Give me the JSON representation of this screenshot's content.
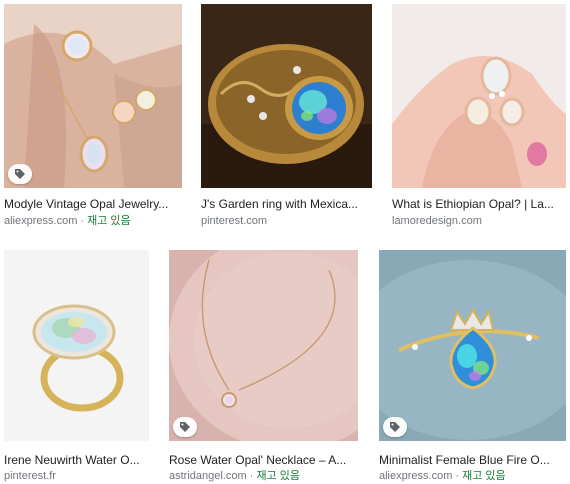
{
  "results": [
    {
      "title": "Modyle Vintage Opal Jewelry...",
      "source": "aliexpress.com",
      "separator": " · ",
      "stock": "재고 있음",
      "tag_icon": "tag-icon"
    },
    {
      "title": "J's Garden ring with Mexica...",
      "source": "pinterest.com",
      "separator": "",
      "stock": "",
      "tag_icon": ""
    },
    {
      "title": "What is Ethiopian Opal? | La...",
      "source": "lamoredesign.com",
      "separator": "",
      "stock": "",
      "tag_icon": ""
    },
    {
      "title": "Irene Neuwirth Water O...",
      "source": "pinterest.fr",
      "separator": "",
      "stock": "",
      "tag_icon": ""
    },
    {
      "title": "Rose Water Opal' Necklace – A...",
      "source": "astridangel.com",
      "separator": " · ",
      "stock": "재고 있음",
      "tag_icon": "tag-icon"
    },
    {
      "title": "Minimalist Female Blue Fire O...",
      "source": "aliexpress.com",
      "separator": " · ",
      "stock": "재고 있음",
      "tag_icon": "tag-icon"
    }
  ],
  "colors": {
    "stock": "#188038",
    "source": "#70757a",
    "title": "#202124"
  }
}
